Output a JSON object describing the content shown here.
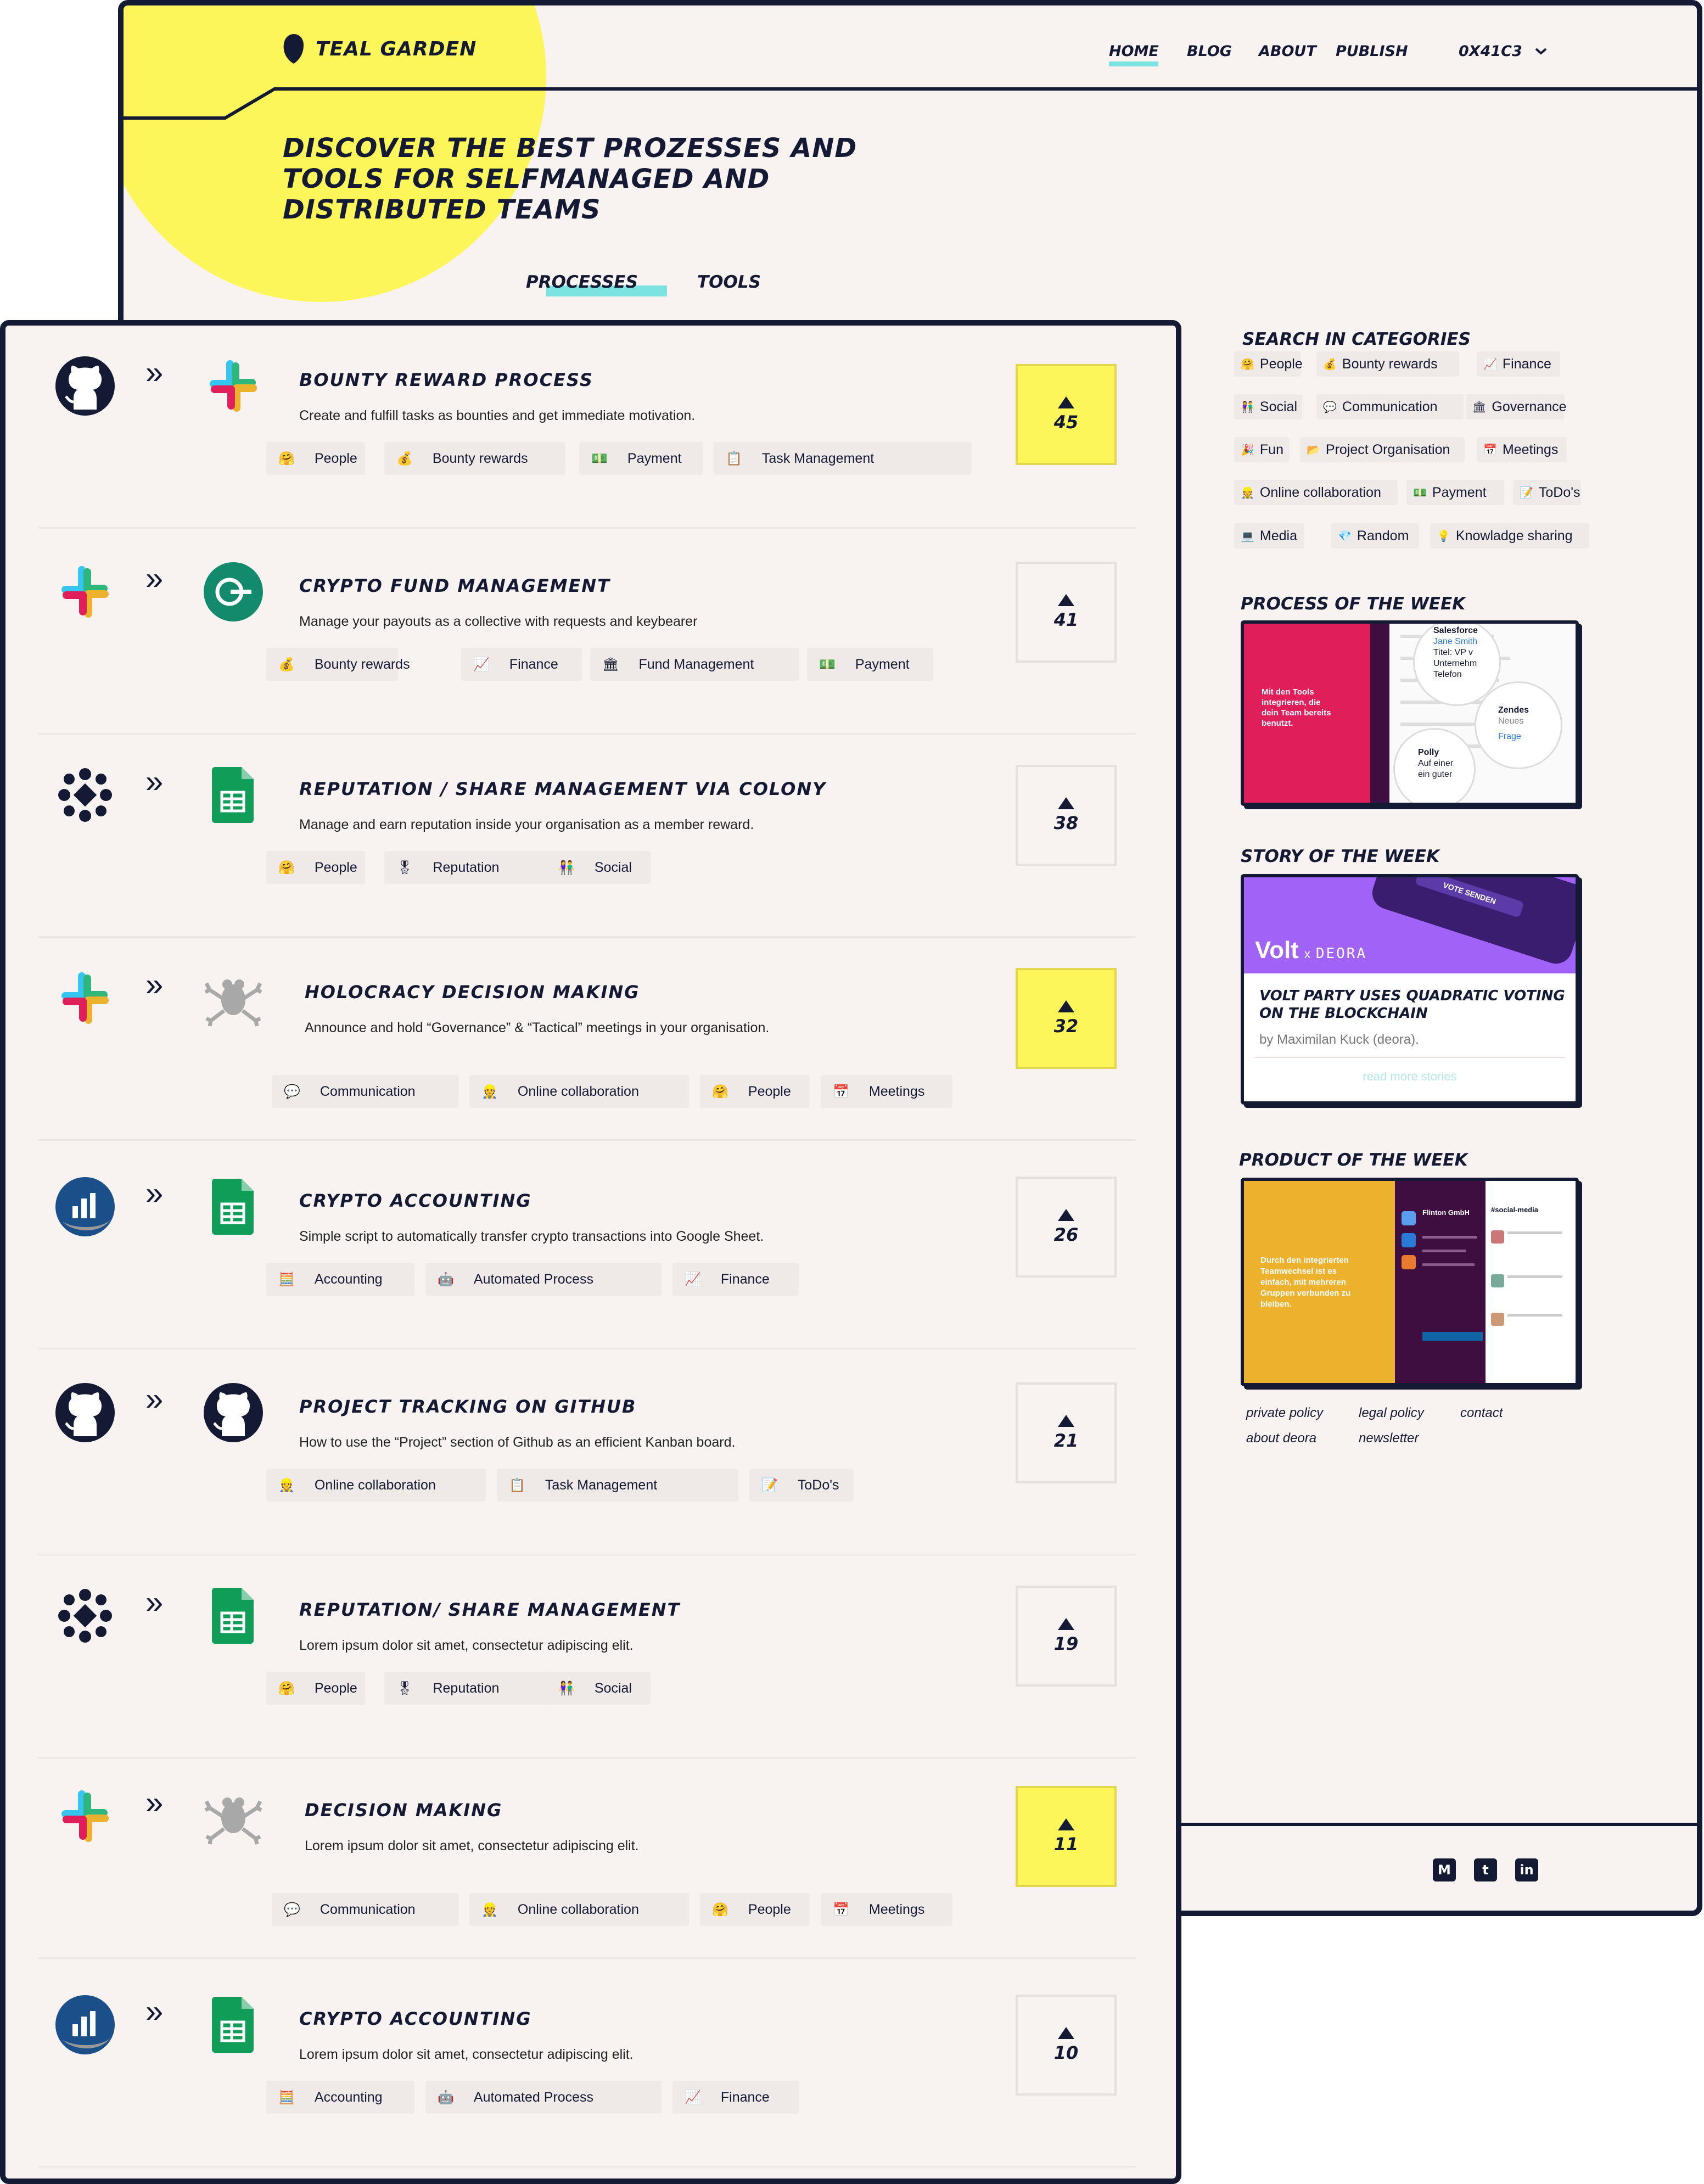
{
  "brand": {
    "name": "TEAL GARDEN"
  },
  "nav": {
    "home": "HOME",
    "blog": "BLOG",
    "about": "ABOUT",
    "publish": "PUBLISH",
    "account": "0X41C3"
  },
  "hero": {
    "line1": "DISCOVER THE BEST PROZESSES AND",
    "line2": "TOOLS FOR SELFMANAGED AND",
    "line3": "DISTRIBUTED TEAMS"
  },
  "tabs": {
    "processes": "PROCESSES",
    "tools": "TOOLS"
  },
  "sidebar": {
    "search_title": "SEARCH IN CATEGORIES",
    "categories": [
      {
        "label": "People",
        "icon": "🤗"
      },
      {
        "label": "Bounty rewards",
        "icon": "💰"
      },
      {
        "label": "Finance",
        "icon": "📈"
      },
      {
        "label": "Social",
        "icon": "👫"
      },
      {
        "label": "Communication",
        "icon": "💬"
      },
      {
        "label": "Governance",
        "icon": "🏛"
      },
      {
        "label": "Fun",
        "icon": "🎉"
      },
      {
        "label": "Project Organisation",
        "icon": "📂"
      },
      {
        "label": "Meetings",
        "icon": "📅"
      },
      {
        "label": "Online collaboration",
        "icon": "👷"
      },
      {
        "label": "Payment",
        "icon": "💵"
      },
      {
        "label": "ToDo's",
        "icon": "📝"
      },
      {
        "label": "Media",
        "icon": "💻"
      },
      {
        "label": "Random",
        "icon": "💎"
      },
      {
        "label": "Knowladge sharing",
        "icon": "💡"
      }
    ],
    "process_week_title": "PROCESS OF THE WEEK",
    "process_week": {
      "blurb": "Mit den Tools integrieren, die dein Team bereits benutzt.",
      "b1": "Salesforce",
      "b1s": "Jane Smith",
      "b1t": "Titel: VP v",
      "b1u": "Unternehm",
      "b1v": "Telefon",
      "b2": "Zendes",
      "b2s": "Neues",
      "b2t": "Frage",
      "b3": "Polly",
      "b3s": "Auf einer",
      "b3t": "ein guter"
    },
    "story_week_title": "STORY OF THE WEEK",
    "story": {
      "brand_left": "Volt",
      "brand_x": "x",
      "brand_right": "DEORA",
      "phone_text": "VOTE SENDEN",
      "title": "VOLT PARTY USES QUADRATIC VOTING ON THE BLOCKCHAIN",
      "byline": "by Maximilan Kuck (deora).",
      "more": "read more stories"
    },
    "product_week_title": "PRODUCT OF THE WEEK",
    "product": {
      "blurb": "Durch den integrierten Teamwechsel ist es einfach, mit mehreren Gruppen verbunden zu bleiben.",
      "org": "Flinton GmbH",
      "channel": "#social-media"
    },
    "footer_links": {
      "private": "private policy",
      "legal": "legal policy",
      "contact": "contact",
      "about": "about deora",
      "newsletter": "newsletter"
    }
  },
  "processes": [
    {
      "title": "BOUNTY REWARD PROCESS",
      "description": "Create and fulfill tasks as bounties and get immediate motivation.",
      "votes": "45",
      "highlight": true,
      "tags": [
        {
          "label": "People",
          "icon": "🤗"
        },
        {
          "label": "Bounty rewards",
          "icon": "💰"
        },
        {
          "label": "Payment",
          "icon": "💵"
        },
        {
          "label": "Task Management",
          "icon": "📋"
        }
      ]
    },
    {
      "title": "CRYPTO FUND MANAGEMENT",
      "description": "Manage your payouts as a collective with requests and keybearer",
      "votes": "41",
      "highlight": false,
      "tags": [
        {
          "label": "Bounty rewards",
          "icon": "💰"
        },
        {
          "label": "Finance",
          "icon": "📈"
        },
        {
          "label": "Fund Management",
          "icon": "🏛"
        },
        {
          "label": "Payment",
          "icon": "💵"
        }
      ]
    },
    {
      "title": "REPUTATION / SHARE MANAGEMENT VIA COLONY",
      "description": "Manage and earn reputation inside your organisation as a member reward.",
      "votes": "38",
      "highlight": false,
      "tags": [
        {
          "label": "People",
          "icon": "🤗"
        },
        {
          "label": "Reputation",
          "icon": "🎖"
        },
        {
          "label": "Social",
          "icon": "👫"
        }
      ]
    },
    {
      "title": "HOLOCRACY DECISION MAKING",
      "description": "Announce and hold “Governance” & “Tactical” meetings in your organisation.",
      "votes": "32",
      "highlight": true,
      "tags": [
        {
          "label": "Communication",
          "icon": "💬"
        },
        {
          "label": "Online collaboration",
          "icon": "👷"
        },
        {
          "label": "People",
          "icon": "🤗"
        },
        {
          "label": "Meetings",
          "icon": "📅"
        }
      ]
    },
    {
      "title": "CRYPTO ACCOUNTING",
      "description": "Simple script to automatically transfer crypto transactions into Google Sheet.",
      "votes": "26",
      "highlight": false,
      "tags": [
        {
          "label": "Accounting",
          "icon": "🧮"
        },
        {
          "label": "Automated Process",
          "icon": "🤖"
        },
        {
          "label": "Finance",
          "icon": "📈"
        }
      ]
    },
    {
      "title": "PROJECT TRACKING ON GITHUB",
      "description": "How to use the “Project” section of Github as an efficient Kanban board.",
      "votes": "21",
      "highlight": false,
      "tags": [
        {
          "label": "Online collaboration",
          "icon": "👷"
        },
        {
          "label": "Task Management",
          "icon": "📋"
        },
        {
          "label": "ToDo's",
          "icon": "📝"
        }
      ]
    },
    {
      "title": "REPUTATION/ SHARE MANAGEMENT",
      "description": "Lorem ipsum dolor sit amet, consectetur adipiscing elit.",
      "votes": "19",
      "highlight": false,
      "tags": [
        {
          "label": "People",
          "icon": "🤗"
        },
        {
          "label": "Reputation",
          "icon": "🎖"
        },
        {
          "label": "Social",
          "icon": "👫"
        }
      ]
    },
    {
      "title": "DECISION MAKING",
      "description": "Lorem ipsum dolor sit amet, consectetur adipiscing elit.",
      "votes": "11",
      "highlight": true,
      "tags": [
        {
          "label": "Communication",
          "icon": "💬"
        },
        {
          "label": "Online collaboration",
          "icon": "👷"
        },
        {
          "label": "People",
          "icon": "🤗"
        },
        {
          "label": "Meetings",
          "icon": "📅"
        }
      ]
    },
    {
      "title": "CRYPTO ACCOUNTING",
      "description": "Lorem ipsum dolor sit amet, consectetur adipiscing elit.",
      "votes": "10",
      "highlight": false,
      "tags": [
        {
          "label": "Accounting",
          "icon": "🧮"
        },
        {
          "label": "Automated Process",
          "icon": "🤖"
        },
        {
          "label": "Finance",
          "icon": "📈"
        }
      ]
    }
  ],
  "colors": {
    "accent_yellow": "#fdf65a",
    "accent_teal": "#7de3e1",
    "navy": "#141a33",
    "background": "#f8f3f1"
  }
}
